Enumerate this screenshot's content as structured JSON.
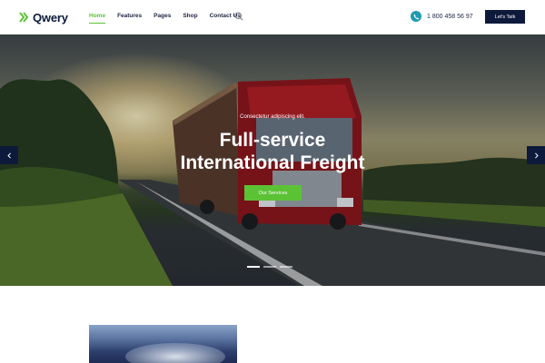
{
  "header": {
    "logo_text": "Qwery",
    "nav": [
      {
        "label": "Home",
        "active": true
      },
      {
        "label": "Features",
        "active": false
      },
      {
        "label": "Pages",
        "active": false
      },
      {
        "label": "Shop",
        "active": false
      },
      {
        "label": "Contact Us",
        "active": false
      }
    ],
    "search_icon": "search-icon",
    "phone_icon": "phone-icon",
    "phone_number": "1 800 458 56 97",
    "cta_label": "Let's Talk"
  },
  "hero": {
    "subtitle": "Consectetur adipiscing elit.",
    "title_line1": "Full-service",
    "title_line2": "International Freight",
    "button_label": "Our Services",
    "prev_icon": "chevron-left-icon",
    "next_icon": "chevron-right-icon",
    "slides_total": 3,
    "active_slide": 1
  },
  "colors": {
    "accent": "#5bc236",
    "navy": "#0e1a3b",
    "phone_teal": "#1f9bb5"
  }
}
